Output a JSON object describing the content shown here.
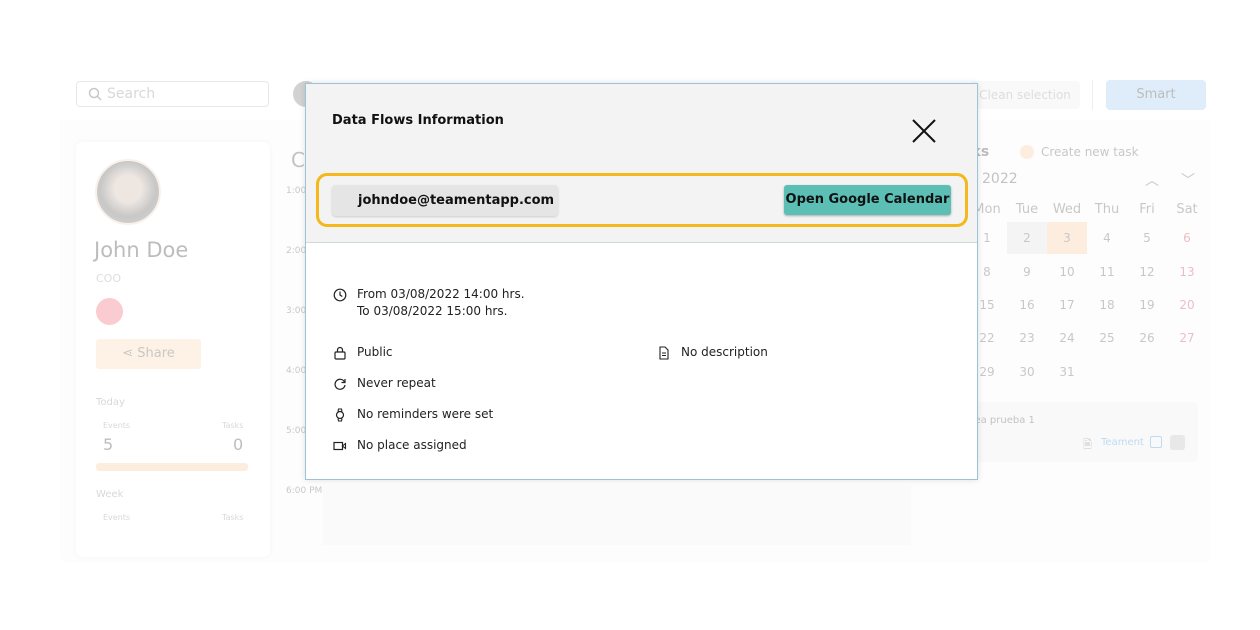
{
  "background": {
    "search_placeholder": "Search",
    "clean_selection": "Clean selection",
    "smart": "Smart",
    "profile": {
      "name": "John Doe",
      "role": "COO",
      "share": "Share",
      "today": "Today",
      "week": "Week",
      "events_label": "Events",
      "tasks_label": "Tasks",
      "today_events": "5",
      "today_tasks": "0"
    },
    "calendar_title": "C",
    "times": [
      "1:00",
      "2:00",
      "3:00",
      "4:00",
      "5:00",
      "6:00 PM"
    ],
    "tasks_title": "Tasks",
    "create_task": "Create new task",
    "month_year": "2022",
    "weekdays": [
      "Mon",
      "Tue",
      "Wed",
      "Thu",
      "Fri",
      "Sat"
    ],
    "weeks": [
      [
        "1",
        "2",
        "3",
        "4",
        "5",
        "6"
      ],
      [
        "8",
        "9",
        "10",
        "11",
        "12",
        "13"
      ],
      [
        "15",
        "16",
        "17",
        "18",
        "19",
        "20"
      ],
      [
        "22",
        "23",
        "24",
        "25",
        "26",
        "27"
      ],
      [
        "29",
        "30",
        "31",
        "",
        "",
        ""
      ]
    ],
    "task_item": {
      "title": "Tarea prueba 1",
      "source": "Teament"
    }
  },
  "modal": {
    "title": "Data Flows Information",
    "email": "johndoe@teamentapp.com",
    "open_button": "Open Google Calendar",
    "from": "From 03/08/2022 14:00 hrs.",
    "to": "To 03/08/2022 15:00 hrs.",
    "visibility": "Public",
    "description": "No description",
    "repeat": "Never repeat",
    "reminders": "No reminders were set",
    "place": "No place assigned",
    "highlight_color": "#f5b81c",
    "button_color": "#5bbfb5"
  }
}
